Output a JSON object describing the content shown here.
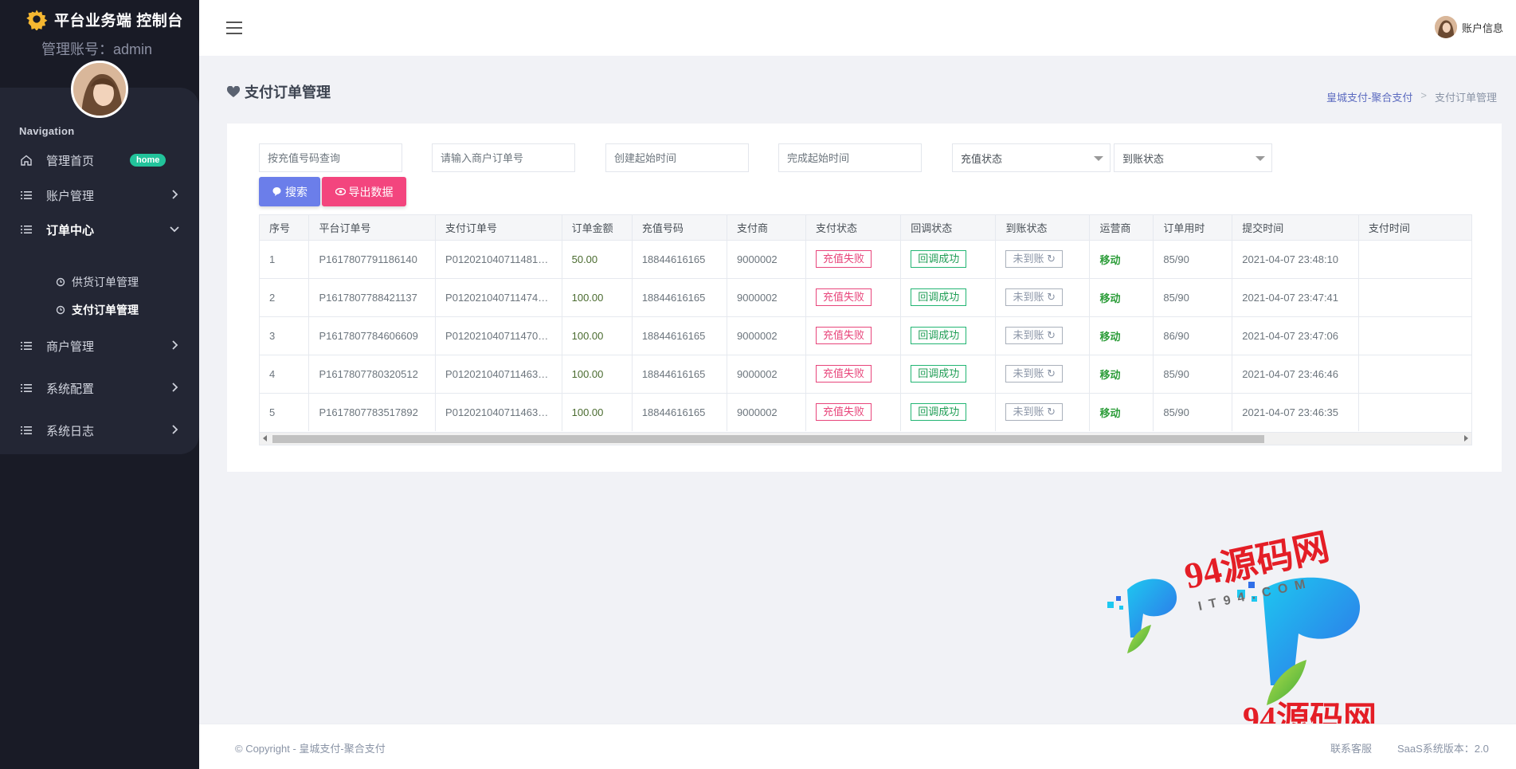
{
  "brand": {
    "title": "平台业务端 控制台",
    "account": "管理账号：admin"
  },
  "nav": {
    "heading": "Navigation",
    "items": [
      {
        "label": "管理首页",
        "badge": "home"
      },
      {
        "label": "账户管理"
      },
      {
        "label": "订单中心"
      },
      {
        "label": "商户管理"
      },
      {
        "label": "系统配置"
      },
      {
        "label": "系统日志"
      }
    ],
    "subitems": [
      {
        "label": "供货订单管理"
      },
      {
        "label": "支付订单管理"
      }
    ]
  },
  "topbar": {
    "user_label": "账户信息"
  },
  "page": {
    "title": "支付订单管理"
  },
  "breadcrumb": {
    "link": "皇城支付-聚合支付",
    "current": "支付订单管理"
  },
  "filters": {
    "recharge_placeholder": "按充值号码查询",
    "merchant_order_placeholder": "请输入商户订单号",
    "create_time_placeholder": "创建起始时间",
    "finish_time_placeholder": "完成起始时间",
    "recharge_status": "充值状态",
    "arrival_status": "到账状态"
  },
  "buttons": {
    "search": "搜索",
    "export": "导出数据"
  },
  "table": {
    "columns": [
      "序号",
      "平台订单号",
      "支付订单号",
      "订单金额",
      "充值号码",
      "支付商",
      "支付状态",
      "回调状态",
      "到账状态",
      "运营商",
      "订单用时",
      "提交时间",
      "支付时间"
    ],
    "rows": [
      {
        "no": "1",
        "platform_order": "P1617807791186140",
        "pay_order": "P0120210407114810...",
        "amount": "50.00",
        "phone": "18844616165",
        "payer": "9000002",
        "pay_status": "充值失败",
        "callback_status": "回调成功",
        "arrival_status": "未到账",
        "carrier": "移动",
        "duration": "85/90",
        "submit_time": "2021-04-07 23:48:10",
        "pay_time": ""
      },
      {
        "no": "2",
        "platform_order": "P1617807788421137",
        "pay_order": "P0120210407114741...",
        "amount": "100.00",
        "phone": "18844616165",
        "payer": "9000002",
        "pay_status": "充值失败",
        "callback_status": "回调成功",
        "arrival_status": "未到账",
        "carrier": "移动",
        "duration": "85/90",
        "submit_time": "2021-04-07 23:47:41",
        "pay_time": ""
      },
      {
        "no": "3",
        "platform_order": "P1617807784606609",
        "pay_order": "P0120210407114706...",
        "amount": "100.00",
        "phone": "18844616165",
        "payer": "9000002",
        "pay_status": "充值失败",
        "callback_status": "回调成功",
        "arrival_status": "未到账",
        "carrier": "移动",
        "duration": "86/90",
        "submit_time": "2021-04-07 23:47:06",
        "pay_time": ""
      },
      {
        "no": "4",
        "platform_order": "P1617807780320512",
        "pay_order": "P0120210407114630...",
        "amount": "100.00",
        "phone": "18844616165",
        "payer": "9000002",
        "pay_status": "充值失败",
        "callback_status": "回调成功",
        "arrival_status": "未到账",
        "carrier": "移动",
        "duration": "85/90",
        "submit_time": "2021-04-07 23:46:46",
        "pay_time": ""
      },
      {
        "no": "5",
        "platform_order": "P1617807783517892",
        "pay_order": "P0120210407114634...",
        "amount": "100.00",
        "phone": "18844616165",
        "payer": "9000002",
        "pay_status": "充值失败",
        "callback_status": "回调成功",
        "arrival_status": "未到账",
        "carrier": "移动",
        "duration": "85/90",
        "submit_time": "2021-04-07 23:46:35",
        "pay_time": ""
      }
    ]
  },
  "footer": {
    "copyright": "© Copyright - 皇城支付-聚合支付",
    "contact": "联系客服",
    "version": "SaaS系统版本：2.0"
  },
  "watermark": {
    "text": "94源码网",
    "sub": "IT94.COM",
    "url": "it94.com"
  },
  "colors": {
    "sidebar": "#191b26",
    "accent_search": "#6b7eea",
    "accent_export": "#f3457e",
    "fail": "#e8457b",
    "success": "#22b573",
    "badge": "#22c39b"
  }
}
